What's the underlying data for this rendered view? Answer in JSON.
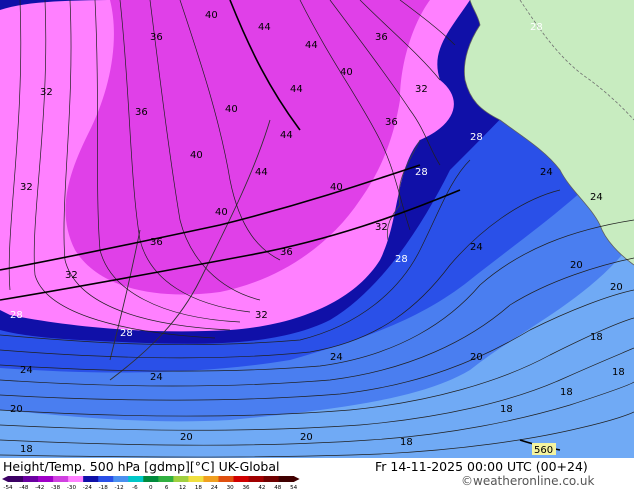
{
  "map": {
    "contour_labels": {
      "level_44": [
        "44",
        "44",
        "44",
        "44",
        "44"
      ],
      "level_40": [
        "40",
        "40",
        "40",
        "40",
        "40",
        "40"
      ],
      "level_36": [
        "36",
        "36",
        "36",
        "36",
        "36",
        "36"
      ],
      "level_32": [
        "32",
        "32",
        "32",
        "32",
        "32",
        "32"
      ],
      "level_28": [
        "28",
        "28",
        "28",
        "28",
        "28",
        "28"
      ],
      "level_24": [
        "24",
        "24",
        "24",
        "24",
        "24",
        "24"
      ],
      "level_20": [
        "20",
        "20",
        "20",
        "20",
        "20",
        "20"
      ],
      "level_18": [
        "18",
        "18",
        "18",
        "18",
        "18",
        "18"
      ]
    },
    "height_contour_label": "560",
    "colors": {
      "deep_magenta": "#e040e8",
      "magenta": "#ff80ff",
      "navy": "#1010a8",
      "blue": "#2a50e8",
      "mid_blue": "#4a7ef0",
      "light_blue": "#70aaf5",
      "land": "#c8ecc0"
    }
  },
  "footer": {
    "title": "Height/Temp. 500 hPa [gdmp][°C] UK-Global",
    "datetime": "Fr 14-11-2025 00:00 UTC (00+24)",
    "credit": "©weatheronline.co.uk"
  },
  "colorbar": {
    "ticks": [
      "-54",
      "-48",
      "-42",
      "-38",
      "-30",
      "-24",
      "-18",
      "-12",
      "-6",
      "0",
      "6",
      "12",
      "18",
      "24",
      "30",
      "36",
      "42",
      "48",
      "54"
    ],
    "colors": [
      "#3c0064",
      "#6a00a0",
      "#a000c8",
      "#d040e0",
      "#ff80ff",
      "#1010a8",
      "#2a50e8",
      "#4a90f0",
      "#00c8c8",
      "#008a3c",
      "#30b040",
      "#a0d040",
      "#f0e040",
      "#f0a020",
      "#e05010",
      "#d00000",
      "#a00000",
      "#700000",
      "#400000"
    ]
  }
}
